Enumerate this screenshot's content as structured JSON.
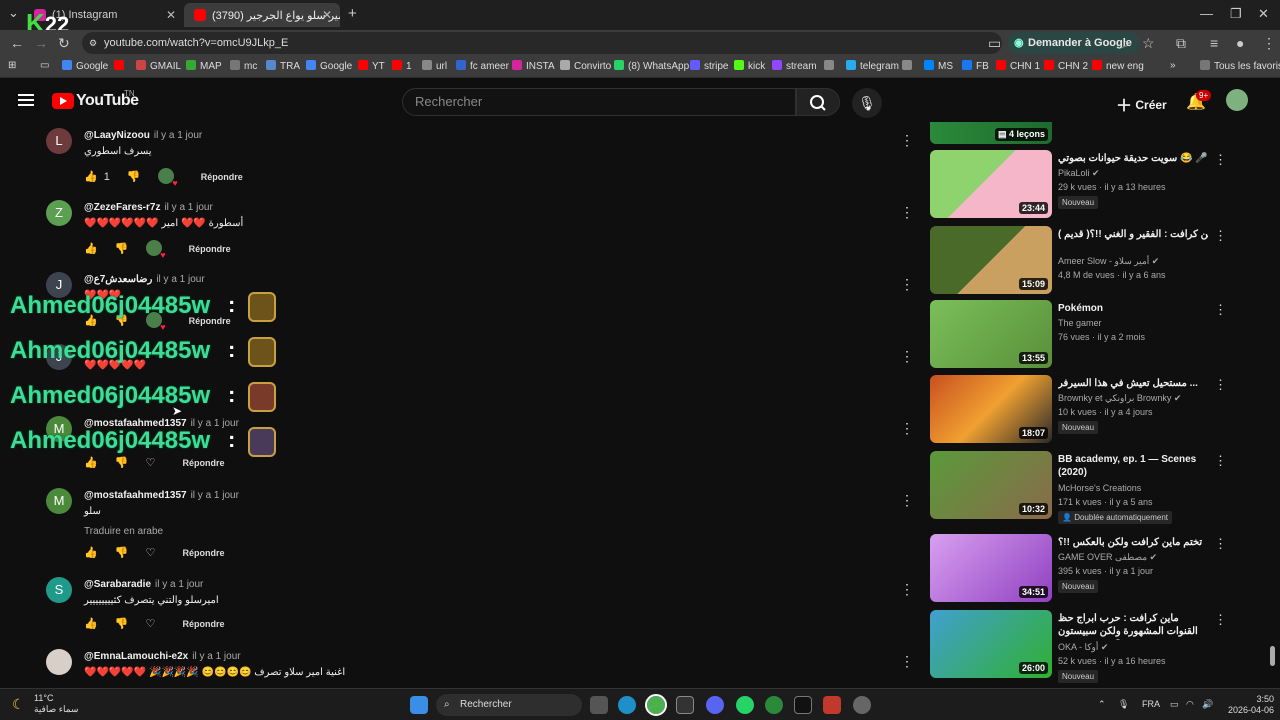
{
  "browser": {
    "tabs": [
      {
        "title": "(1) Instagram"
      },
      {
        "title": "(3790) أمير سلو يواع الجرجير 👏"
      }
    ],
    "new_tab": "+",
    "url": "youtube.com/watch?v=omcU9JLkp_E",
    "translate_button": "Demander à Google",
    "bookmarks": [
      "Google",
      "GMAIL",
      "MAP",
      "mc",
      "TRA",
      "Google",
      "YT",
      "1",
      "url",
      "fc ameer",
      "INSTA",
      "Convirto",
      "(8) WhatsApp",
      "stripe",
      "kick",
      "stream",
      "telegram",
      "MS",
      "FB",
      "CHN 1",
      "CHN 2",
      "new eng"
    ],
    "all_favorites": "Tous les favoris"
  },
  "watermark": {
    "letter": "K",
    "number": "22"
  },
  "youtube": {
    "logo": "YouTube",
    "country": "TN",
    "search_placeholder": "Rechercher",
    "create": "Créer",
    "notif_count": "9+"
  },
  "comments": [
    {
      "initial": "L",
      "color": "#6d3b3b",
      "author": "@LaayNizoou",
      "when": "il y a 1 jour",
      "text": "يسرف اسطوري",
      "likes": "1",
      "reply": "Répondre"
    },
    {
      "initial": "Z",
      "color": "#5aa050",
      "author": "@ZezeFares-r7z",
      "when": "il y a 1 jour",
      "text": "❤️❤️❤️❤️❤️❤️ أسطورة ❤️❤️ امير",
      "likes": "",
      "reply": "Répondre"
    },
    {
      "initial": "J",
      "color": "#3d4450",
      "author": "@رضاسعدش7ع",
      "when": "il y a 1 jour",
      "text": "❤️❤️❤️",
      "likes": "",
      "reply": "Répondre"
    },
    {
      "initial": "J",
      "color": "#3d4450",
      "author": "",
      "when": "",
      "text": "❤️❤️❤️❤️❤️",
      "likes": "",
      "reply": "Répondre"
    },
    {
      "initial": "M",
      "color": "#4a8a3a",
      "author": "@mostafaahmed1357",
      "when": "il y a 1 jour",
      "text": "",
      "likes": "",
      "reply": "Répondre"
    },
    {
      "initial": "M",
      "color": "#4a8a3a",
      "author": "@mostafaahmed1357",
      "when": "il y a 1 jour",
      "text": "سلو",
      "translate": "Traduire en arabe",
      "likes": "",
      "reply": "Répondre"
    },
    {
      "initial": "S",
      "color": "#1f9a8a",
      "author": "@Sarabaradie",
      "when": "il y a 1 jour",
      "text": "اميرسلو والتني يتصرف كثيييييييير",
      "likes": "",
      "reply": "Répondre"
    },
    {
      "initial": "",
      "color": "#cfcfcf",
      "author": "@EmnaLamouchi-e2x",
      "when": "il y a 1 jour",
      "text": "❤️❤️❤️❤️❤️ 🎉🎉🎉🎉 😊😊😊😊 اغنية امير سلاو تصرف",
      "likes": "",
      "reply": "Répondre"
    }
  ],
  "overlay_chat": [
    {
      "name": "Ahmed06j04485w",
      "sep": ":"
    },
    {
      "name": "Ahmed06j04485w",
      "sep": ":"
    },
    {
      "name": "Ahmed06j04485w",
      "sep": ":"
    },
    {
      "name": "Ahmed06j04485w",
      "sep": ":"
    }
  ],
  "recommendations": [
    {
      "title": "",
      "badge": "4 leçons",
      "colors": [
        "#2a8a3a",
        "#1e6a2e"
      ]
    },
    {
      "title": "سويت حديقة حيوانات بصوتي 😂 🎤",
      "channel": "PikaLoli ✔",
      "meta": "29 k vues · il y a 13 heures",
      "badge": "Nouveau",
      "duration": "23:44",
      "colors": [
        "#f4b6c8",
        "#8ed36e"
      ]
    },
    {
      "title": "قلم ماين كرافت : الفقير و الغني !!؟( قديم ) 💔😱",
      "channel": "Ameer Slow - أمير سلاو ✔",
      "meta": "4,8 M de vues · il y a 6 ans",
      "badge": "",
      "duration": "15:09",
      "colors": [
        "#4a6a2a",
        "#c9a060"
      ]
    },
    {
      "title": "Pokémon",
      "channel": "The gamer",
      "meta": "76 vues · il y a 2 mois",
      "badge": "",
      "duration": "13:55",
      "colors": [
        "#7abf5a",
        "#5a8f3a"
      ]
    },
    {
      "title": "مستحيل تعيش في هذا السيرفر ...",
      "channel": "Brownky et براونكي Brownky ✔",
      "meta": "10 k vues · il y a 4 jours",
      "badge": "Nouveau",
      "duration": "18:07",
      "colors": [
        "#c85020",
        "#2a2a2a"
      ]
    },
    {
      "title": "BB academy, ep. 1 — Scenes (2020)",
      "channel": "McHorse's Creations",
      "meta": "171 k vues · il y a 5 ans",
      "badge": "Doublée automatiquement",
      "duration": "10:32",
      "colors": [
        "#5a9a3a",
        "#8a6a4a"
      ]
    },
    {
      "title": "تختم ماين كرافت ولكن بالعكس !!؟",
      "channel": "GAME OVER مصطفى ✔",
      "meta": "395 k vues · il y a 1 jour",
      "badge": "Nouveau",
      "duration": "34:51",
      "colors": [
        "#d8a0f0",
        "#9040c0"
      ]
    },
    {
      "title": "ماين كرافت : حرب ابراج حظ القنوات المشهورة ولكن سبيستون ضد MBC 3 !!؟...",
      "channel": "OKA - أوكا ✔",
      "meta": "52 k vues · il y a 16 heures",
      "badge": "Nouveau",
      "duration": "26:00",
      "colors": [
        "#40a0d0",
        "#30b030"
      ]
    }
  ],
  "taskbar": {
    "weather_temp": "11°C",
    "weather_desc": "سماء صافية",
    "search": "Rechercher",
    "lang": "FRA",
    "time": "3:50",
    "date": "2026-04-06"
  }
}
